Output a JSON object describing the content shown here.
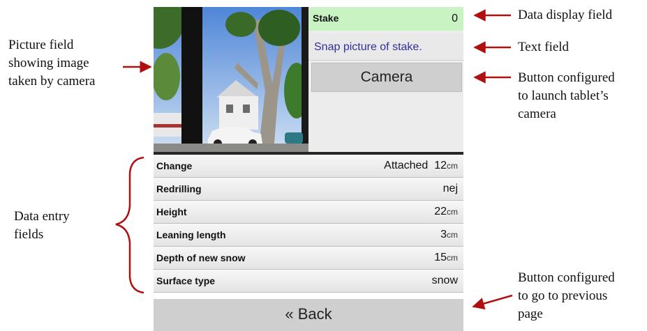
{
  "annotations": {
    "picture_field": [
      "Picture field",
      "showing image",
      "taken by camera"
    ],
    "data_display_field": "Data display field",
    "text_field": "Text field",
    "camera_button": [
      "Button configured",
      "to launch tablet’s",
      "camera"
    ],
    "data_entry_fields": [
      "Data entry",
      "fields"
    ],
    "back_button": [
      "Button configured",
      "to go to previous",
      "page"
    ]
  },
  "device": {
    "stake_label": "Stake",
    "stake_value": "0",
    "text_field": "Snap picture of stake.",
    "camera_button": "Camera",
    "rows": [
      {
        "label": "Change",
        "value": "Attached  12",
        "unit": "cm"
      },
      {
        "label": "Redrilling",
        "value": "nej",
        "unit": ""
      },
      {
        "label": "Height",
        "value": "22",
        "unit": "cm"
      },
      {
        "label": "Leaning length",
        "value": "3",
        "unit": "cm"
      },
      {
        "label": "Depth of new snow",
        "value": "15",
        "unit": "cm"
      },
      {
        "label": "Surface type",
        "value": "snow",
        "unit": ""
      }
    ],
    "back_button": "« Back"
  },
  "colors": {
    "arrow": "#b01010",
    "data_display_bg": "#c9f3c2",
    "text_field_color": "#303099",
    "button_bg": "#cfcfcf"
  }
}
